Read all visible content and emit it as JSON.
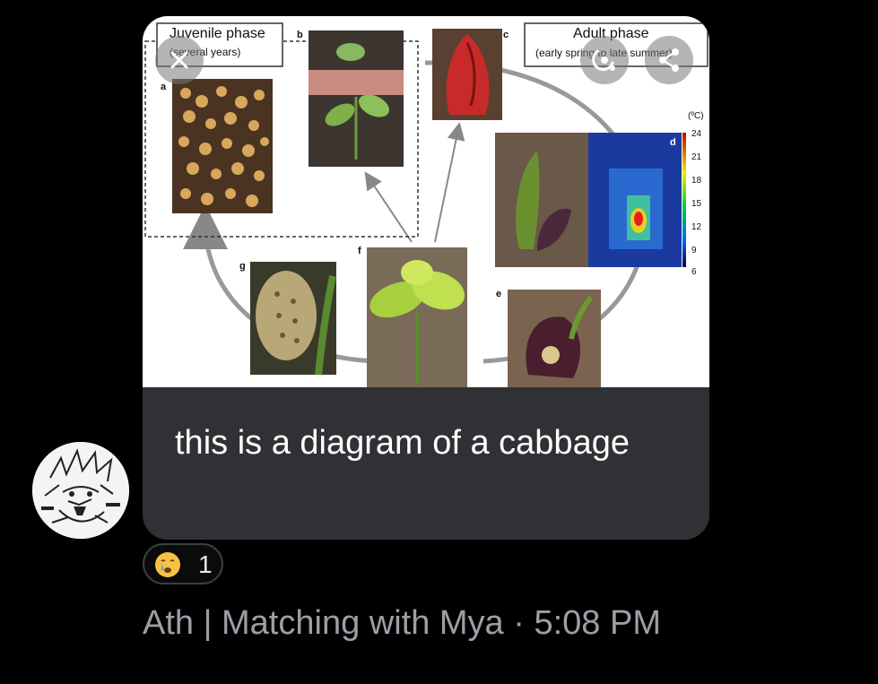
{
  "message": {
    "caption": "this is a diagram of a cabbage",
    "sender": "Ath | Matching with Mya",
    "separator": "·",
    "time": "5:08 PM",
    "reaction": {
      "emoji_icon": "crying-face-emoji",
      "count": "1"
    }
  },
  "attachment": {
    "juvenile_title": "Juvenile phase",
    "juvenile_sub": "(several years)",
    "adult_title": "Adult phase",
    "adult_sub": "(early spring to late summer)",
    "panel_a": "a",
    "panel_b": "b",
    "panel_c": "c",
    "panel_d": "d",
    "panel_e": "e",
    "panel_f": "f",
    "panel_g": "g",
    "temp_unit": "(ºC)",
    "temp_ticks": [
      "24",
      "21",
      "18",
      "15",
      "12",
      "9",
      "6"
    ]
  },
  "overlay": {
    "close_icon": "close-icon",
    "lens_icon": "lens-icon",
    "share_icon": "share-icon"
  },
  "colors": {
    "background": "#000000",
    "bubble": "#303134",
    "caption_text": "#ffffff",
    "meta_text": "#9aa0a6"
  }
}
